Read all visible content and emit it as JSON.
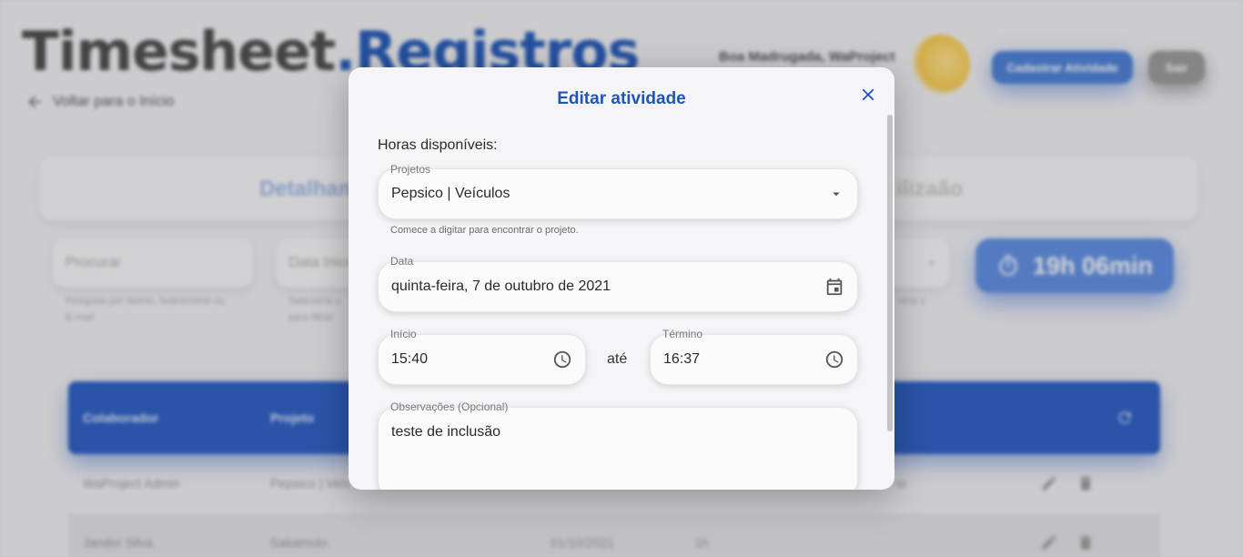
{
  "background": {
    "title_part1": "Timesheet",
    "title_part2": ".Registros",
    "back_link": "Voltar para o Início",
    "greeting": "Boa Madrugada, WaProject",
    "register_button": "Cadastrar Atividade",
    "logout_button": "Sair",
    "tab_details": "Detalham",
    "tab_other": "ilizaão",
    "search_placeholder": "Procurar",
    "search_helper_1": "Pesquise por Nome, Sobrenome ou",
    "search_helper_2": "E-mail",
    "date_start_placeholder": "Data Inicio",
    "date_helper_1": "Selecione u",
    "date_helper_2": "para filtrar",
    "filter_helper": "ntrar c",
    "total_time": "19h 06min",
    "table_headers": [
      "Colaborador",
      "Projeto"
    ],
    "rows": [
      {
        "collaborator": "WaProject Admin",
        "project": "Pepsico | Veíc",
        "date": "",
        "hours": "",
        "extra": "io"
      },
      {
        "collaborator": "Jander Silva",
        "project": "Sakamoto",
        "date": "01/10/2021",
        "hours": "1h",
        "extra": ""
      }
    ]
  },
  "modal": {
    "title": "Editar atividade",
    "hours_available": "Horas disponíveis:",
    "project_label": "Projetos",
    "project_value": "Pepsico | Veículos",
    "project_helper": "Comece a digitar para encontrar o projeto.",
    "date_label": "Data",
    "date_value": "quinta-feira, 7 de outubro de 2021",
    "start_label": "Início",
    "start_value": "15:40",
    "between": "até",
    "end_label": "Término",
    "end_value": "16:37",
    "notes_label": "Observações (Opcional)",
    "notes_value": "teste de inclusão"
  },
  "colors": {
    "primary": "#1f55b5",
    "header_blue": "#2a5ec4",
    "accent_blue": "#4a7fd6"
  }
}
